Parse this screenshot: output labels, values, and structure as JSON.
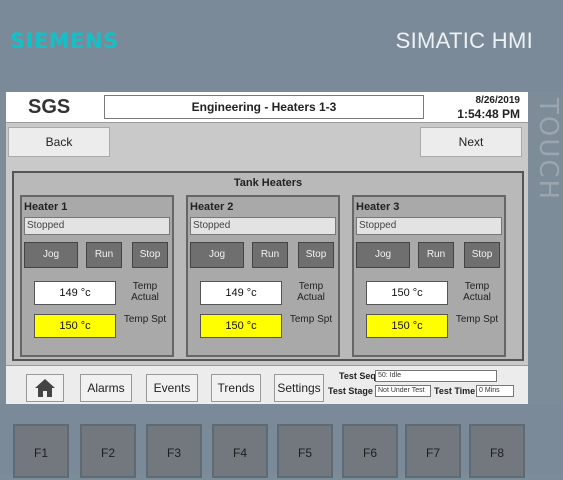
{
  "bezel": {
    "brand": "SIEMENS",
    "title": "SIMATIC HMI",
    "vertical": "TOUCH"
  },
  "header": {
    "logo": "SGS",
    "title": "Engineering - Heaters 1-3",
    "date": "8/26/2019",
    "time": "1:54:48 PM"
  },
  "nav": {
    "back": "Back",
    "next": "Next"
  },
  "panel": {
    "title": "Tank Heaters"
  },
  "heaters": [
    {
      "name": "Heater 1",
      "status": "Stopped",
      "jog": "Jog",
      "run": "Run",
      "stop": "Stop",
      "temp_actual": "149 °c",
      "temp_spt": "150 °c",
      "label_actual": "Temp Actual",
      "label_spt": "Temp Spt"
    },
    {
      "name": "Heater 2",
      "status": "Stopped",
      "jog": "Jog",
      "run": "Run",
      "stop": "Stop",
      "temp_actual": "149 °c",
      "temp_spt": "150 °c",
      "label_actual": "Temp Actual",
      "label_spt": "Temp Spt"
    },
    {
      "name": "Heater 3",
      "status": "Stopped",
      "jog": "Jog",
      "run": "Run",
      "stop": "Stop",
      "temp_actual": "150 °c",
      "temp_spt": "150 °c",
      "label_actual": "Temp Actual",
      "label_spt": "Temp Spt"
    }
  ],
  "bottom": {
    "alarms": "Alarms",
    "events": "Events",
    "trends": "Trends",
    "settings": "Settings",
    "test_seq_label": "Test Seq",
    "test_seq_value": "50: Idle",
    "test_stage_label": "Test Stage",
    "test_stage_value": "Not Under Test",
    "test_time_label": "Test Time",
    "test_time_value": "0 Mins"
  },
  "fkeys": [
    "F1",
    "F2",
    "F3",
    "F4",
    "F5",
    "F6",
    "F7",
    "F8"
  ],
  "colors": {
    "brand": "#12c0c8",
    "setpoint_bg": "#ffff00",
    "actual_bg": "#ffffff"
  }
}
